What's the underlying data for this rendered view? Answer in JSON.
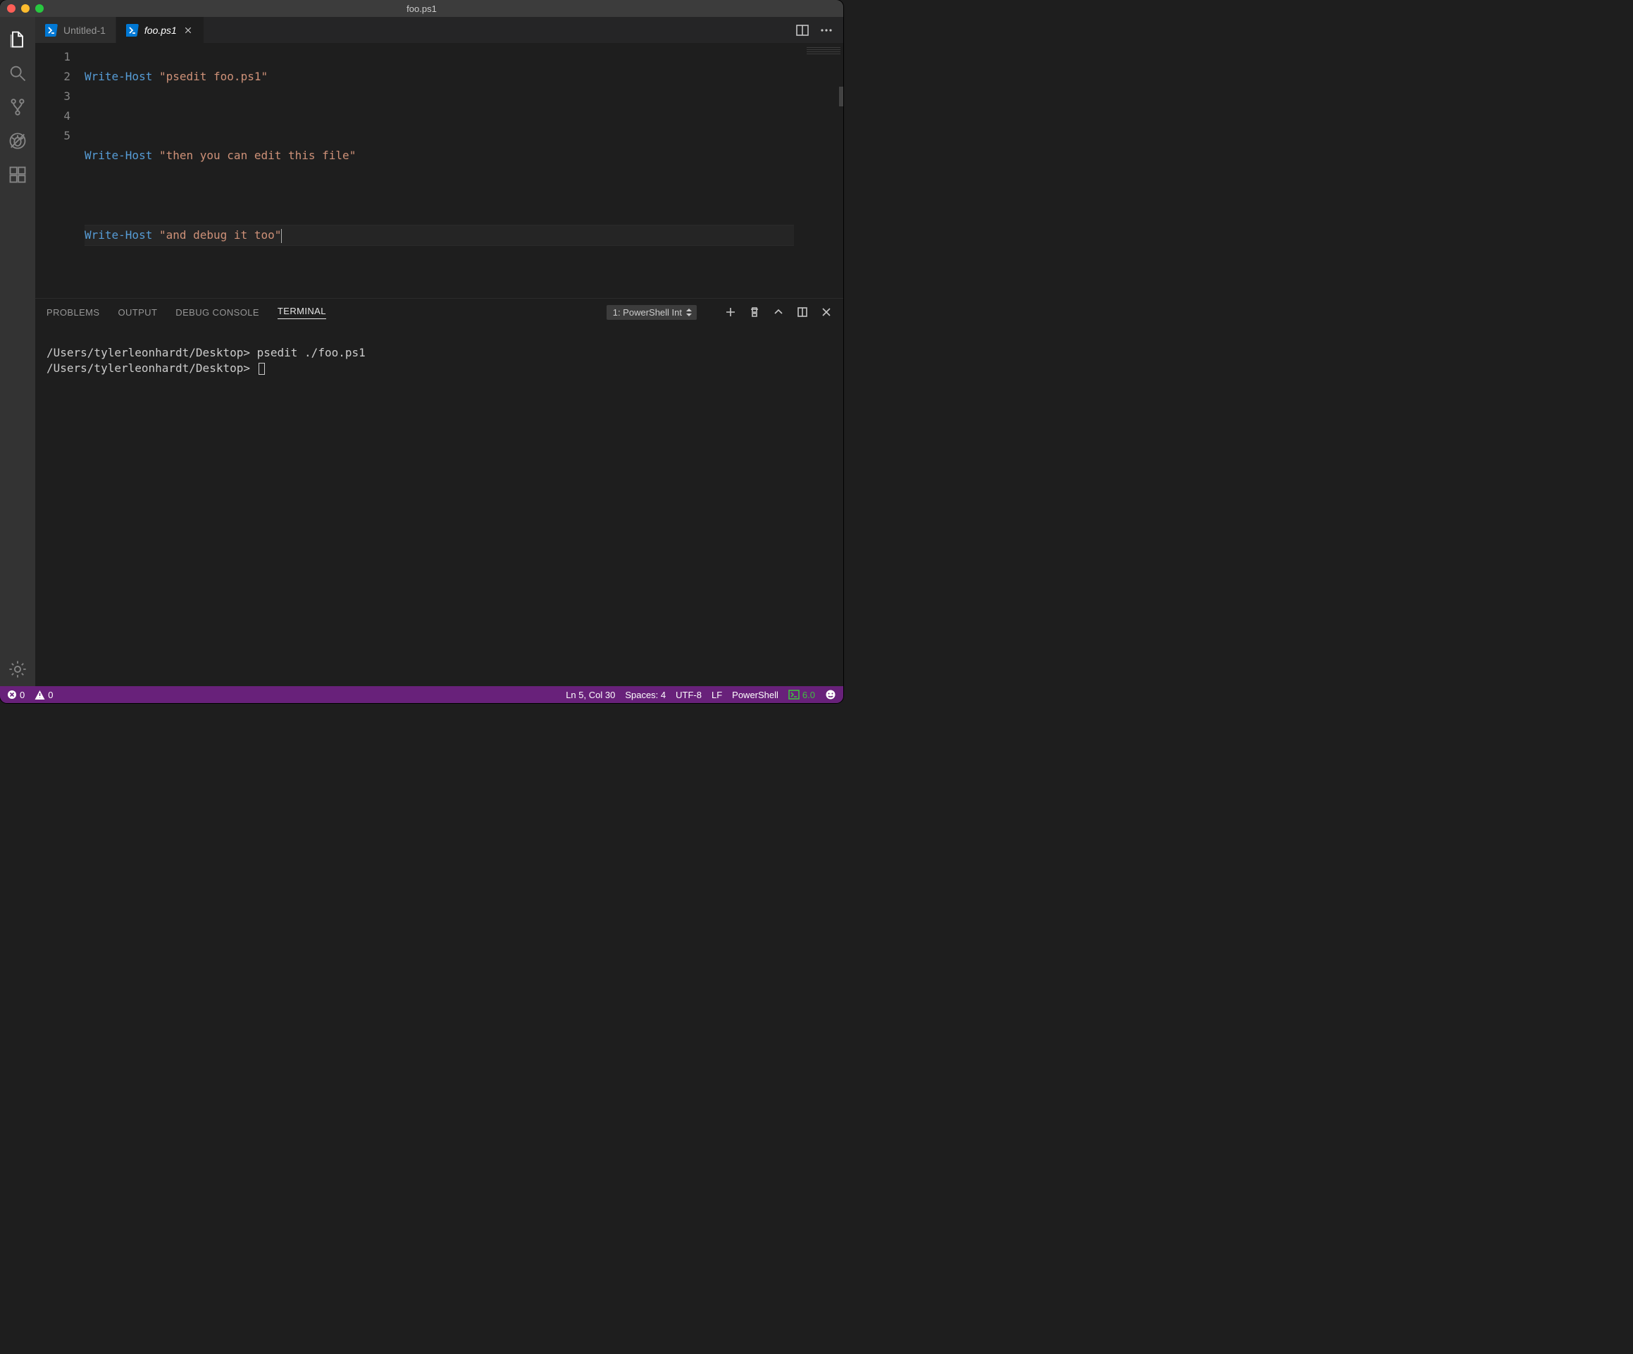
{
  "window": {
    "title": "foo.ps1"
  },
  "tabs": [
    {
      "label": "Untitled-1",
      "active": false,
      "italic": false
    },
    {
      "label": "foo.ps1",
      "active": true,
      "italic": true
    }
  ],
  "editor": {
    "line_numbers": [
      "1",
      "2",
      "3",
      "4",
      "5"
    ],
    "lines": [
      {
        "cmd": "Write-Host",
        "str": "\"psedit foo.ps1\""
      },
      {
        "cmd": "",
        "str": ""
      },
      {
        "cmd": "Write-Host",
        "str": "\"then you can edit this file\""
      },
      {
        "cmd": "",
        "str": ""
      },
      {
        "cmd": "Write-Host",
        "str": "\"and debug it too\""
      }
    ],
    "active_line_index": 4
  },
  "panel": {
    "tabs": {
      "problems": "PROBLEMS",
      "output": "OUTPUT",
      "debug": "DEBUG CONSOLE",
      "terminal": "TERMINAL"
    },
    "active_tab": "terminal",
    "terminal_selector": "1: PowerShell Int",
    "terminal_lines": [
      "/Users/tylerleonhardt/Desktop> psedit ./foo.ps1",
      "/Users/tylerleonhardt/Desktop> "
    ]
  },
  "statusbar": {
    "errors": "0",
    "warnings": "0",
    "cursor": "Ln 5, Col 30",
    "indent": "Spaces: 4",
    "encoding": "UTF-8",
    "eol": "LF",
    "language": "PowerShell",
    "ps_version": "6.0"
  },
  "icons": {
    "activity_files": "files-icon",
    "activity_search": "search-icon",
    "activity_scm": "source-control-icon",
    "activity_debug": "debug-icon",
    "activity_ext": "extensions-icon",
    "activity_gear": "gear-icon"
  }
}
